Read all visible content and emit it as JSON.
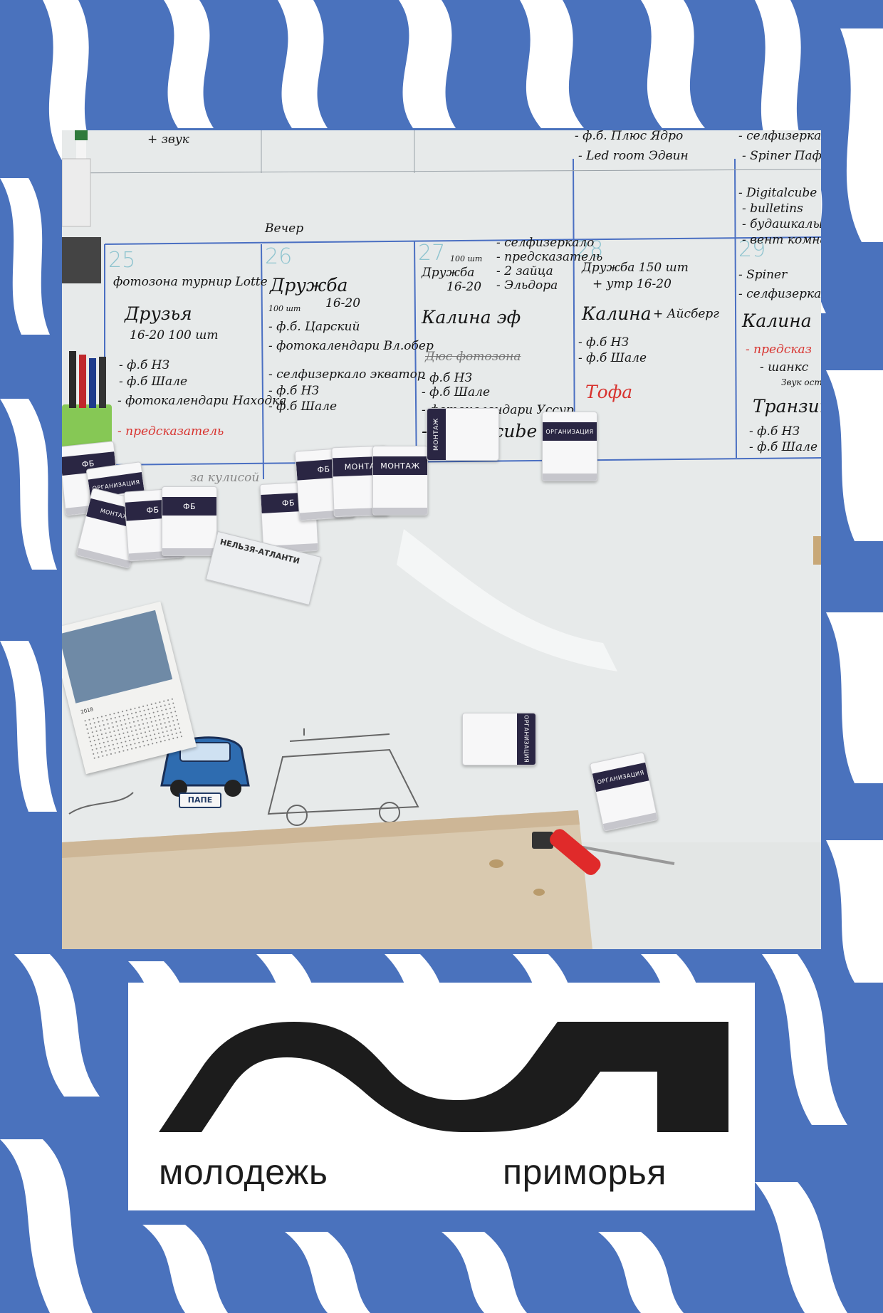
{
  "colors": {
    "zebra_blue": "#4a72bd",
    "frame_white": "#ffffff",
    "logo_black": "#1c1c1c",
    "card_band": "#2a2643",
    "marker_red": "#d8322e",
    "day_number_teal": "#8fc4cf"
  },
  "logo": {
    "icon": "wave-mp-logo-icon",
    "tagline_left": "молодежь",
    "tagline_right": "приморья"
  },
  "photo": {
    "whiteboard": {
      "top_notes": [
        "+ звук",
        "- ф.б. Плюс Ядро",
        "- Led room Эдвин",
        "- селфизеркало",
        "- Spiner Паф",
        "- Digitalcube",
        "- bulletins",
        "- будашкалы",
        "- вент комнаты"
      ],
      "day_numbers": [
        "25",
        "26",
        "27",
        "28",
        "29"
      ],
      "evening_label": "Вечер",
      "col_25": [
        "фотозона турнир Lotte",
        "Друзья",
        "16-20 100 шт",
        "- ф.б НЗ",
        "- ф.б Шале",
        "- фотокалендари Находка",
        "- предсказатель"
      ],
      "col_26": [
        "Дружба",
        "16-20",
        "100 шт",
        "- ф.б. Царский",
        "- фотокалендари Вл.обер",
        "- селфизеркало экватор",
        "- ф.б НЗ",
        "- ф.б Шале"
      ],
      "col_27": [
        "Дружба",
        "100 шт",
        "16-20",
        "- селфизеркало",
        "- предсказатель",
        "- 2 зайца",
        "- Эльдора",
        "Калина эф",
        "Дюс фотозона",
        "- ф.б НЗ",
        "- ф.б Шале",
        "- фотокалендари Уссур.",
        "- Digitalcube"
      ],
      "col_28": [
        "Дружба 150 шт",
        "+ утр 16-20",
        "Калина",
        "+ Айсберг",
        "- ф.б НЗ",
        "- ф.б Шале",
        "Тофа"
      ],
      "col_29": [
        "- Spiner",
        "- селфизеркало",
        "Калина",
        "- предсказ",
        "- шанкс",
        "Звук ост",
        "Транзит",
        "- ф.б НЗ",
        "- ф.б Шале"
      ],
      "bottom_scribble": "за кулисой"
    },
    "cards": {
      "fb": "ФБ",
      "montage": "МОНТАЖ",
      "montage_short": "МОНТА",
      "organization": "ОРГАНИЗАЦИЯ"
    },
    "calendar_year": "2018",
    "magnet_text": "НЕЛЬЗЯ-АТЛАНТИ",
    "car_magnet_label": "ПАПЕ"
  }
}
